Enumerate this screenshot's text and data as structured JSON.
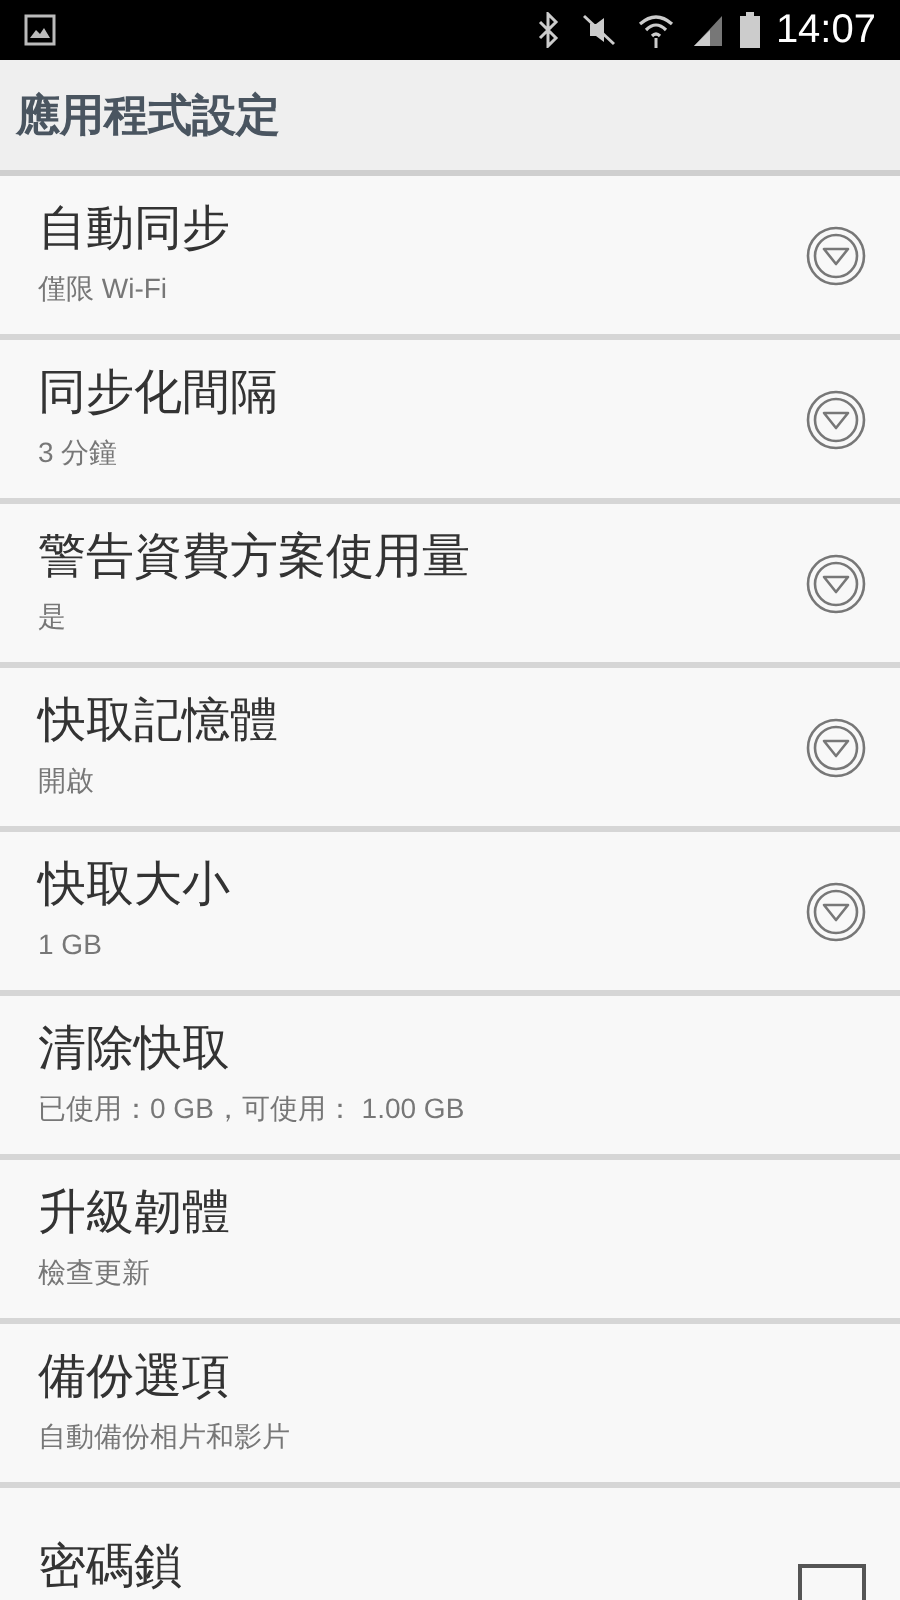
{
  "status_bar": {
    "time": "14:07"
  },
  "header": {
    "title": "應用程式設定"
  },
  "settings": [
    {
      "kind": "dropdown",
      "title": "自動同步",
      "subtitle": "僅限 Wi-Fi"
    },
    {
      "kind": "dropdown",
      "title": "同步化間隔",
      "subtitle": "3 分鐘"
    },
    {
      "kind": "dropdown",
      "title": "警告資費方案使用量",
      "subtitle": "是"
    },
    {
      "kind": "dropdown",
      "title": "快取記憶體",
      "subtitle": "開啟"
    },
    {
      "kind": "dropdown",
      "title": "快取大小",
      "subtitle": "1 GB"
    },
    {
      "kind": "plain",
      "title": "清除快取",
      "subtitle": "已使用：0 GB，可使用： 1.00 GB"
    },
    {
      "kind": "plain",
      "title": "升級韌體",
      "subtitle": "檢查更新"
    },
    {
      "kind": "plain",
      "title": "備份選項",
      "subtitle": "自動備份相片和影片"
    },
    {
      "kind": "checkbox",
      "title": "密碼鎖",
      "checked": false
    }
  ]
}
